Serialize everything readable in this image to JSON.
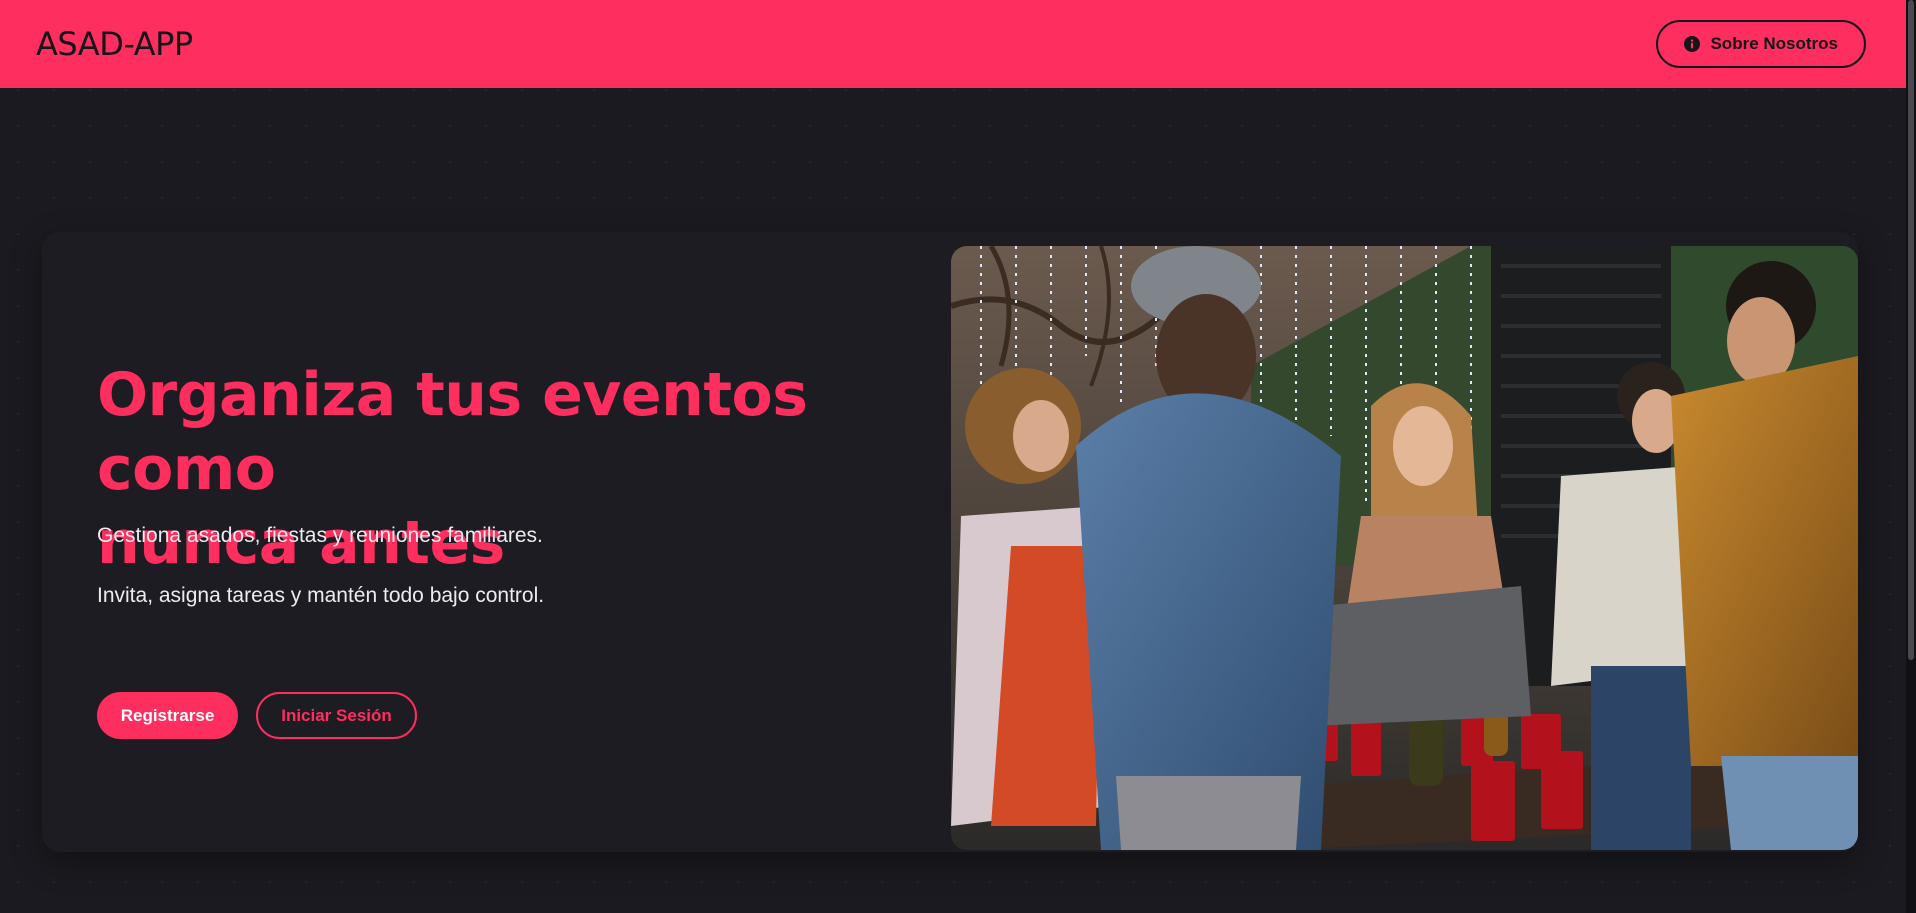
{
  "navbar": {
    "brand": "ASAD-APP",
    "about_label": "Sobre Nosotros",
    "about_icon": "info-circle-icon",
    "background": "#fe2e5e"
  },
  "hero": {
    "title_line1": "Organiza tus eventos como",
    "title_line2": "nunca antes",
    "subtitle1": "Gestiona asados, fiestas y reuniones familiares.",
    "subtitle2": "Invita, asigna tareas y mantén todo bajo control.",
    "register_label": "Registrarse",
    "login_label": "Iniciar Sesión",
    "accent_color": "#fe2e5e",
    "photo": "group-of-friends-outdoor-party-photo"
  }
}
